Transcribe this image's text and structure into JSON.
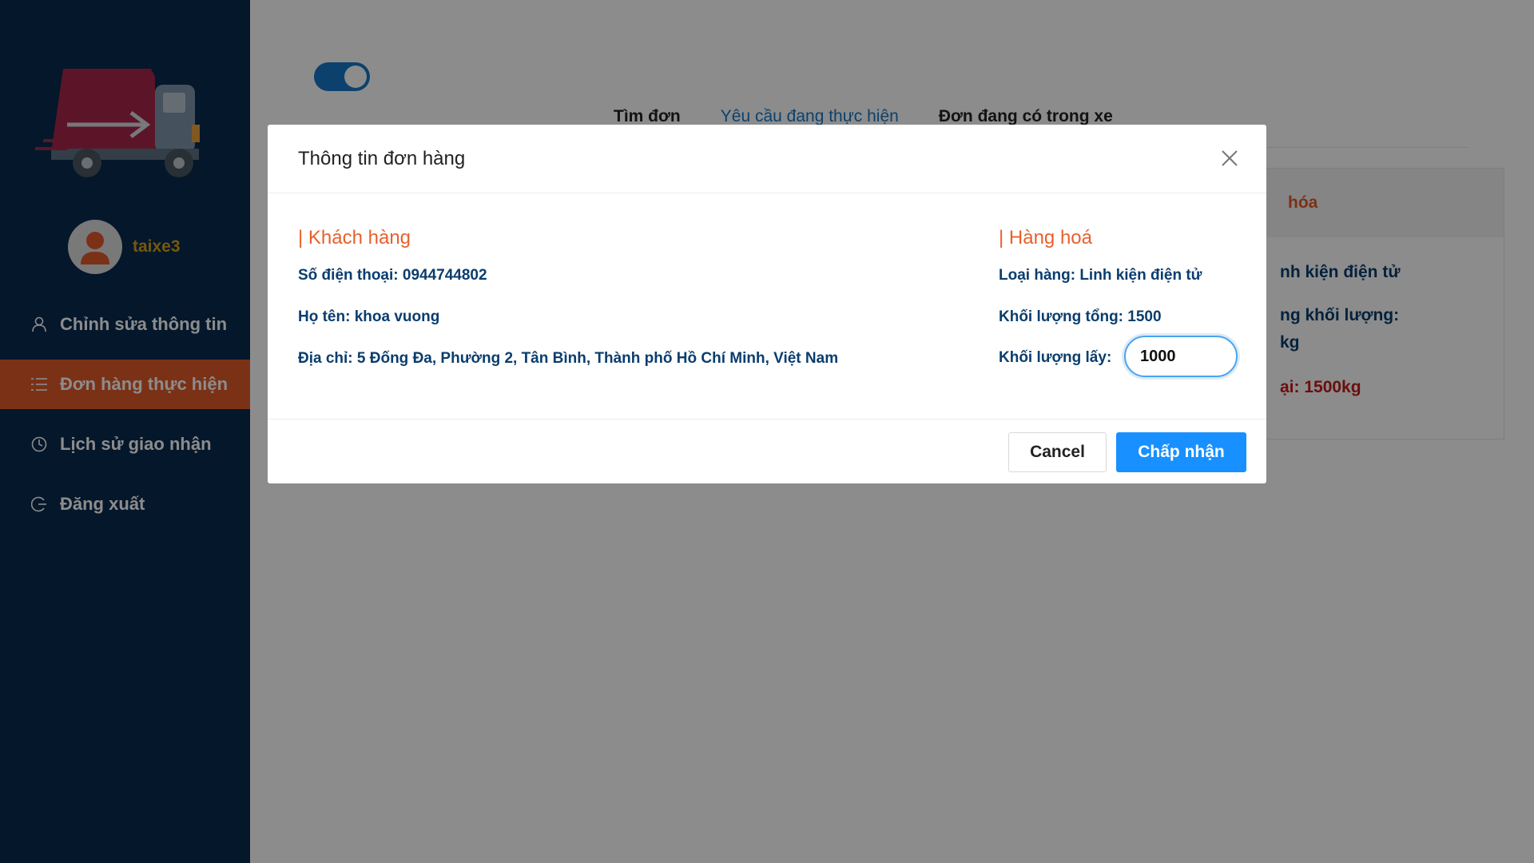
{
  "sidebar": {
    "username": "taixe3",
    "items": [
      {
        "label": "Chỉnh sửa thông tin",
        "icon": "user-icon",
        "active": false
      },
      {
        "label": "Đơn hàng thực hiện",
        "icon": "list-icon",
        "active": true
      },
      {
        "label": "Lịch sử giao nhận",
        "icon": "clock-icon",
        "active": false
      },
      {
        "label": "Đăng xuất",
        "icon": "logout-icon",
        "active": false
      }
    ]
  },
  "main": {
    "tabs": [
      {
        "label": "Tìm đơn"
      },
      {
        "label": "Yêu cầu đang thực hiện"
      },
      {
        "label": "Đơn đang có trong xe"
      }
    ],
    "card": {
      "header": "hóa",
      "line1": "nh kiện điện tử",
      "line2": "ng khối lượng:",
      "line3": "kg",
      "line4": "ại: 1500kg"
    }
  },
  "modal": {
    "title": "Thông tin đơn hàng",
    "customer": {
      "section_title": "| Khách hàng",
      "phone": "Số điện thoại: 0944744802",
      "name": "Họ tên: khoa vuong",
      "address": "Địa chỉ: 5 Đống Đa, Phường 2, Tân Bình, Thành phố Hồ Chí Minh, Việt Nam"
    },
    "goods": {
      "section_title": "| Hàng hoá",
      "type": "Loại hàng: Linh kiện điện tử",
      "total_weight": "Khối lượng tổng: 1500",
      "take_weight_label": "Khối lượng lấy:",
      "take_weight_value": "1000"
    },
    "cancel_label": "Cancel",
    "ok_label": "Chấp nhận"
  },
  "colors": {
    "sidebar_bg": "#0a2a4f",
    "accent_orange": "#e05a28",
    "primary_blue": "#1890ff",
    "text_navy": "#0a3d6e",
    "username_gold": "#d4a017"
  }
}
